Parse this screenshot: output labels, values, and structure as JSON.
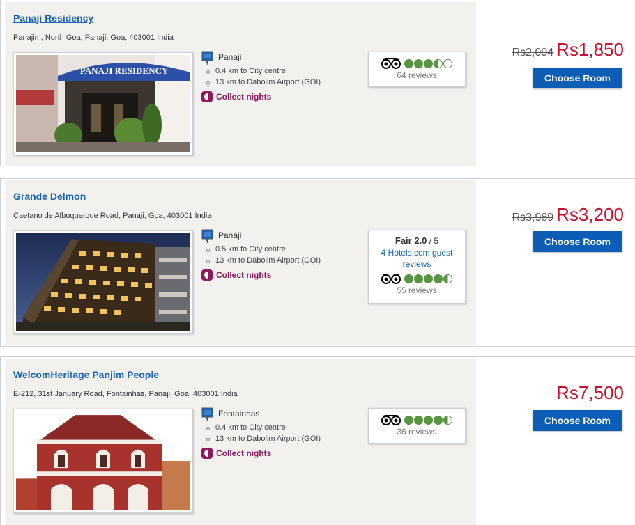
{
  "hotels": [
    {
      "name": "Panaji Residency",
      "address": "Panajim, North Goa, Panaji, Goa, 403001 India",
      "area": "Panaji",
      "distances": [
        "0.4 km to City centre",
        "13 km to Dabolim Airport (GOI)"
      ],
      "collect": "Collect nights",
      "photo_sign": "PANAJI RESIDENCY",
      "tripadvisor": {
        "rating": 3.5,
        "reviews": "64 reviews"
      },
      "old_price": "Rs2,094",
      "price": "Rs1,850",
      "button": "Choose Room"
    },
    {
      "name": "Grande Delmon",
      "address": "Caetano de Albuquerque Road, Panaji, Goa, 403001 India",
      "area": "Panaji",
      "distances": [
        "0.5 km to City centre",
        "13 km to Dabolim Airport (GOI)"
      ],
      "collect": "Collect nights",
      "hotels_rating": {
        "label": "Fair 2.0",
        "out_of": " / 5",
        "guest": "4 Hotels.com guest reviews"
      },
      "tripadvisor": {
        "rating": 4.5,
        "reviews": "55 reviews"
      },
      "old_price": "Rs3,989",
      "price": "Rs3,200",
      "button": "Choose Room"
    },
    {
      "name": "WelcomHeritage Panjim People",
      "address": "E-212, 31st January Road, Fontainhas, Panaji, Goa, 403001 India",
      "area": "Fontainhas",
      "distances": [
        "0.4 km to City centre",
        "13 km to Dabolim Airport (GOI)"
      ],
      "collect": "Collect nights",
      "tripadvisor": {
        "rating": 4.5,
        "reviews": "36 reviews"
      },
      "price": "Rs7,500",
      "button": "Choose Room"
    }
  ],
  "colors": {
    "link": "#1a63b8",
    "price": "#c8102e",
    "button": "#0b5db6",
    "collect": "#8e1a5b",
    "bubble": "#589442"
  }
}
